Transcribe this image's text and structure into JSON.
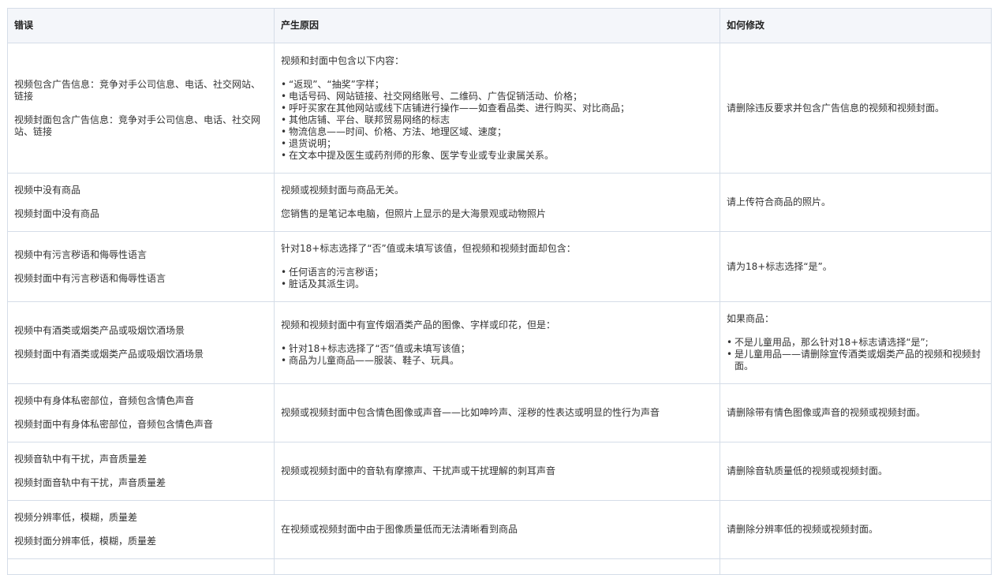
{
  "table": {
    "headers": [
      "错误",
      "产生原因",
      "如何修改"
    ],
    "rows": [
      {
        "error": [
          "视频包含广告信息：竞争对手公司信息、电话、社交网站、链接",
          "视频封面包含广告信息：竞争对手公司信息、电话、社交网站、链接"
        ],
        "cause": {
          "lead": "视频和封面中包含以下内容：",
          "items": [
            "“返现”、“抽奖”字样；",
            "电话号码、网站链接、社交网络账号、二维码、广告促销活动、价格；",
            "呼吁买家在其他网站或线下店铺进行操作——如查看品类、进行购买、对比商品；",
            "其他店铺、平台、联邦贸易网络的标志",
            "物流信息——时间、价格、方法、地理区域、速度；",
            "退货说明；",
            "在文本中提及医生或药剂师的形象、医学专业或专业隶属关系。"
          ]
        },
        "fix": {
          "text": "请删除违反要求并包含广告信息的视频和视频封面。"
        }
      },
      {
        "error": [
          "视频中没有商品",
          "视频封面中没有商品"
        ],
        "cause": {
          "paras": [
            "视频或视频封面与商品无关。",
            "您销售的是笔记本电脑，但照片上显示的是大海景观或动物照片"
          ]
        },
        "fix": {
          "text": "请上传符合商品的照片。"
        }
      },
      {
        "error": [
          "视频中有污言秽语和侮辱性语言",
          "视频封面中有污言秽语和侮辱性语言"
        ],
        "cause": {
          "lead": "针对18+标志选择了“否”值或未填写该值，但视频和视频封面却包含：",
          "items": [
            "任何语言的污言秽语；",
            "脏话及其派生词。"
          ]
        },
        "fix": {
          "text": "请为18+标志选择“是”。"
        }
      },
      {
        "error": [
          "视频中有酒类或烟类产品或吸烟饮酒场景",
          "视频封面中有酒类或烟类产品或吸烟饮酒场景"
        ],
        "cause": {
          "lead": "视频和视频封面中有宣传烟酒类产品的图像、字样或印花，但是：",
          "items": [
            "针对18+标志选择了“否”值或未填写该值；",
            "商品为儿童商品——服装、鞋子、玩具。"
          ]
        },
        "fix": {
          "lead": "如果商品：",
          "items": [
            "不是儿童用品，那么针对18+标志请选择“是”;",
            "是儿童用品——请删除宣传酒类或烟类产品的视频和视频封面。"
          ]
        }
      },
      {
        "error": [
          "视频中有身体私密部位，音频包含情色声音",
          "视频封面中有身体私密部位，音频包含情色声音"
        ],
        "cause": {
          "text": "视频或视频封面中包含情色图像或声音——比如呻吟声、淫秽的性表达或明显的性行为声音"
        },
        "fix": {
          "text": "请删除带有情色图像或声音的视频或视频封面。"
        }
      },
      {
        "error": [
          "视频音轨中有干扰，声音质量差",
          "视频封面音轨中有干扰，声音质量差"
        ],
        "cause": {
          "text": "视频或视频封面中的音轨有摩擦声、干扰声或干扰理解的刺耳声音"
        },
        "fix": {
          "text": "请删除音轨质量低的视频或视频封面。"
        }
      },
      {
        "error": [
          "视频分辨率低，模糊，质量差",
          "视频封面分辨率低，模糊，质量差"
        ],
        "cause": {
          "text": "在视频或视频封面中由于图像质量低而无法清晰看到商品"
        },
        "fix": {
          "text": "请删除分辨率低的视频或视频封面。"
        }
      }
    ]
  }
}
